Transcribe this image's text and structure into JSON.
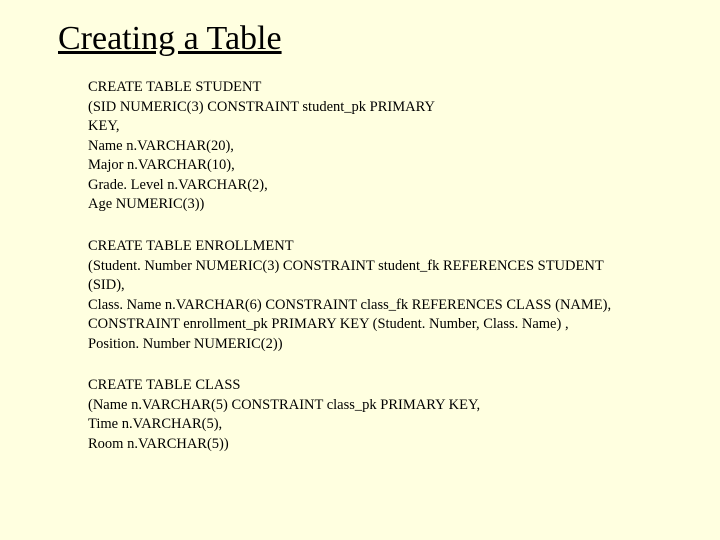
{
  "title": "Creating a Table",
  "blocks": {
    "student": {
      "l1": "CREATE TABLE STUDENT",
      "l2": "(SID NUMERIC(3) CONSTRAINT student_pk PRIMARY",
      "l3": "KEY,",
      "l4": "Name n.VARCHAR(20),",
      "l5": "Major n.VARCHAR(10),",
      "l6": "Grade. Level n.VARCHAR(2),",
      "l7": "Age NUMERIC(3))"
    },
    "enrollment": {
      "l1": "CREATE TABLE ENROLLMENT",
      "l2": "(Student. Number NUMERIC(3) CONSTRAINT student_fk REFERENCES STUDENT",
      "l3": "(SID),",
      "l4": "Class. Name n.VARCHAR(6) CONSTRAINT class_fk REFERENCES CLASS (NAME),",
      "l5": "CONSTRAINT enrollment_pk PRIMARY KEY (Student. Number, Class. Name) ,",
      "l6": "Position. Number NUMERIC(2))"
    },
    "class": {
      "l1": "CREATE TABLE CLASS",
      "l2": "(Name n.VARCHAR(5) CONSTRAINT class_pk PRIMARY KEY,",
      "l3": "Time n.VARCHAR(5),",
      "l4": "Room n.VARCHAR(5))"
    }
  }
}
